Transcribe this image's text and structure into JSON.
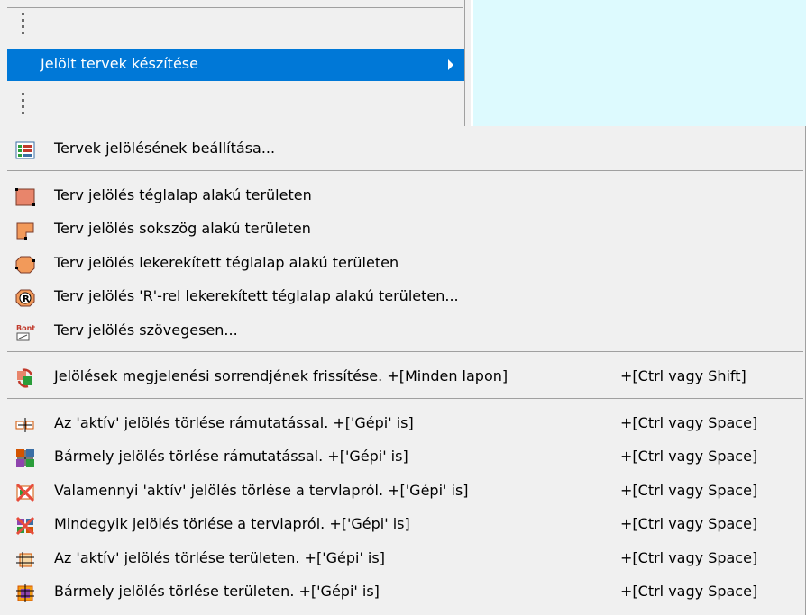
{
  "parent_menu": {
    "highlighted_item": "Jelölt tervek készítése"
  },
  "submenu": {
    "groups": [
      [
        {
          "label": "Tervek jelölésének beállítása...",
          "shortcut": "",
          "icon": "marking-settings-icon"
        }
      ],
      [
        {
          "label": "Terv jelölés téglalap alakú területen",
          "shortcut": "",
          "icon": "rectangle-area-icon"
        },
        {
          "label": "Terv jelölés sokszög alakú területen",
          "shortcut": "",
          "icon": "polygon-area-icon"
        },
        {
          "label": "Terv jelölés lekerekített téglalap alakú területen",
          "shortcut": "",
          "icon": "rounded-rectangle-area-icon"
        },
        {
          "label": "Terv jelölés 'R'-rel lekerekített téglalap alakú területen...",
          "shortcut": "",
          "icon": "r-rounded-rectangle-icon"
        },
        {
          "label": "Terv jelölés szövegesen...",
          "shortcut": "",
          "icon": "text-marking-icon"
        }
      ],
      [
        {
          "label": "Jelölések megjelenési sorrendjének frissítése. +[Minden lapon]",
          "shortcut": "+[Ctrl vagy Shift]",
          "icon": "refresh-order-icon"
        }
      ],
      [
        {
          "label": "Az 'aktív' jelölés törlése rámutatással. +['Gépi' is]",
          "shortcut": "+[Ctrl vagy Space]",
          "icon": "delete-active-pointer-icon"
        },
        {
          "label": "Bármely jelölés törlése rámutatással. +['Gépi' is]",
          "shortcut": "+[Ctrl vagy Space]",
          "icon": "delete-any-pointer-icon"
        },
        {
          "label": "Valamennyi 'aktív' jelölés törlése a tervlapról. +['Gépi' is]",
          "shortcut": "+[Ctrl vagy Space]",
          "icon": "delete-all-active-icon"
        },
        {
          "label": "Mindegyik jelölés törlése a tervlapról. +['Gépi' is]",
          "shortcut": "+[Ctrl vagy Space]",
          "icon": "delete-all-icon"
        },
        {
          "label": "Az 'aktív' jelölés törlése területen. +['Gépi' is]",
          "shortcut": "+[Ctrl vagy Space]",
          "icon": "delete-active-area-icon"
        },
        {
          "label": "Bármely jelölés törlése területen. +['Gépi' is]",
          "shortcut": "+[Ctrl vagy Space]",
          "icon": "delete-any-area-icon"
        }
      ]
    ]
  },
  "colors": {
    "highlight": "#0078d7",
    "menu_background": "#f0f0f0",
    "panel_background": "#ddfafe",
    "separator": "#a0a0a0"
  }
}
